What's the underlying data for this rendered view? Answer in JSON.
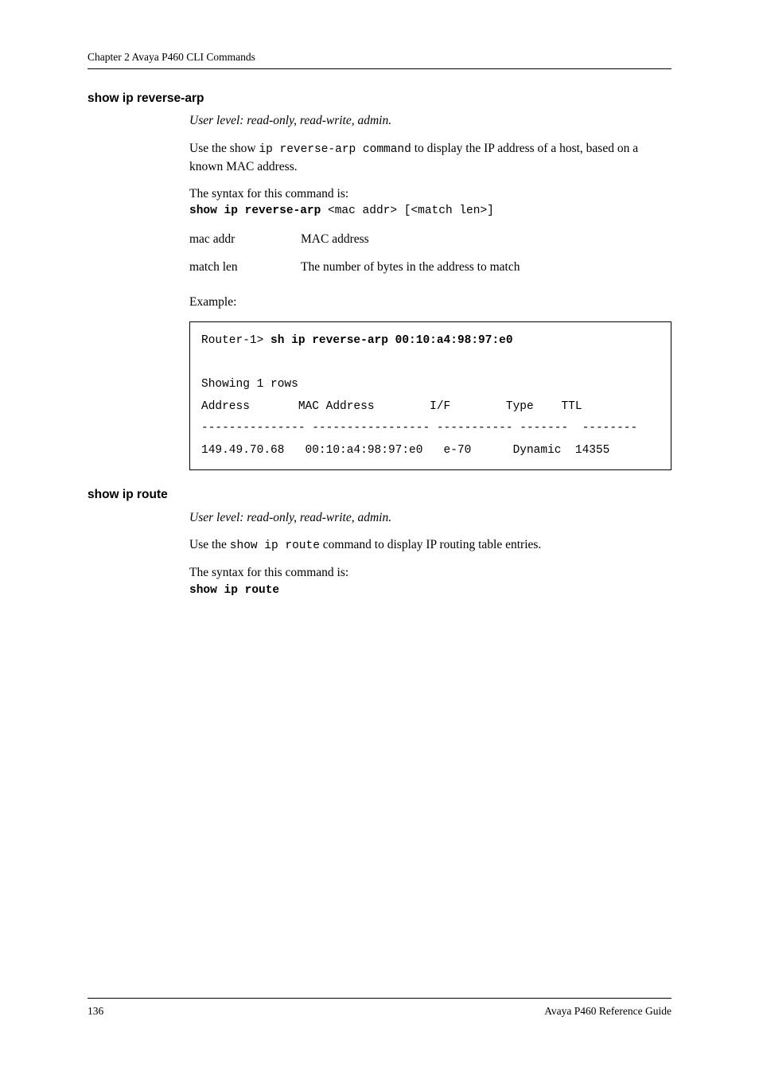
{
  "page": {
    "running_head": "Chapter 2       Avaya P460 CLI Commands",
    "footer_left": "136",
    "footer_right": "Avaya P460 Reference Guide"
  },
  "section1": {
    "heading": "show ip reverse-arp",
    "userlevel": "User level: read-only, read-write, admin.",
    "intro_pre": "Use the show ",
    "intro_code1": "ip reverse-arp command",
    "intro_post": "  to display the IP address of a host, based on a known MAC address.",
    "syntax_intro": "The syntax for this command is:",
    "syntax_cmd": "show ip reverse-arp",
    "syntax_args": " <mac addr> [<match len>]",
    "arg1_name": "mac addr",
    "arg1_desc": "MAC address",
    "arg2_name": "match len",
    "arg2_desc": "The number of bytes in the address to match",
    "example_label": "Example:",
    "example_prompt": "Router-1> ",
    "example_cmd": "sh ip reverse-arp 00:10:a4:98:97:e0",
    "example_out1": "Showing 1 rows",
    "example_out2": "Address       MAC Address        I/F        Type    TTL",
    "example_out3": "--------------- ----------------- ----------- -------  --------",
    "example_out4": "149.49.70.68   00:10:a4:98:97:e0   e-70      Dynamic  14355"
  },
  "section2": {
    "heading": "show ip route",
    "userlevel": "User level: read-only, read-write, admin.",
    "intro_pre": "Use the  ",
    "intro_code1": "show ip route",
    "intro_post": "  command to display IP routing table entries.",
    "syntax_intro": "The syntax for this command is:",
    "syntax_cmd": "show ip route"
  }
}
